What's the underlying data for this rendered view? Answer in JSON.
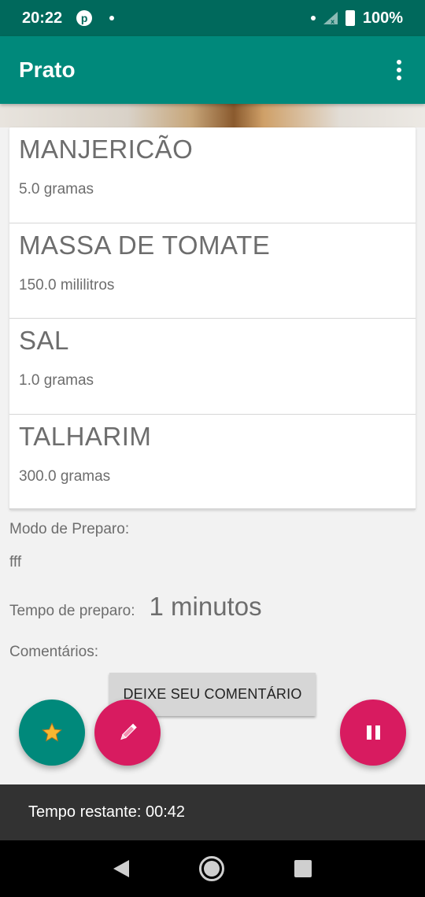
{
  "status_bar": {
    "time": "20:22",
    "battery": "100%"
  },
  "app_bar": {
    "title": "Prato"
  },
  "ingredients": [
    {
      "name": "MANJERICÃO",
      "quantity": "5.0 gramas"
    },
    {
      "name": "MASSA DE TOMATE",
      "quantity": "150.0 mililitros"
    },
    {
      "name": "SAL",
      "quantity": "1.0 gramas"
    },
    {
      "name": "TALHARIM",
      "quantity": "300.0 gramas"
    }
  ],
  "details": {
    "prep_label": "Modo de Preparo:",
    "prep_text": "fff",
    "time_label": "Tempo de preparo:",
    "time_value": "1 minutos",
    "comments_label": "Comentários:"
  },
  "comment_button_label": "DEIXE SEU COMENTÁRIO",
  "snackbar": {
    "text": "Tempo restante: 00:42"
  },
  "colors": {
    "status_bar": "#00695c",
    "app_bar": "#00897b",
    "fab_favorite": "#00897b",
    "fab_accent": "#d81b60",
    "snackbar": "#323232"
  }
}
